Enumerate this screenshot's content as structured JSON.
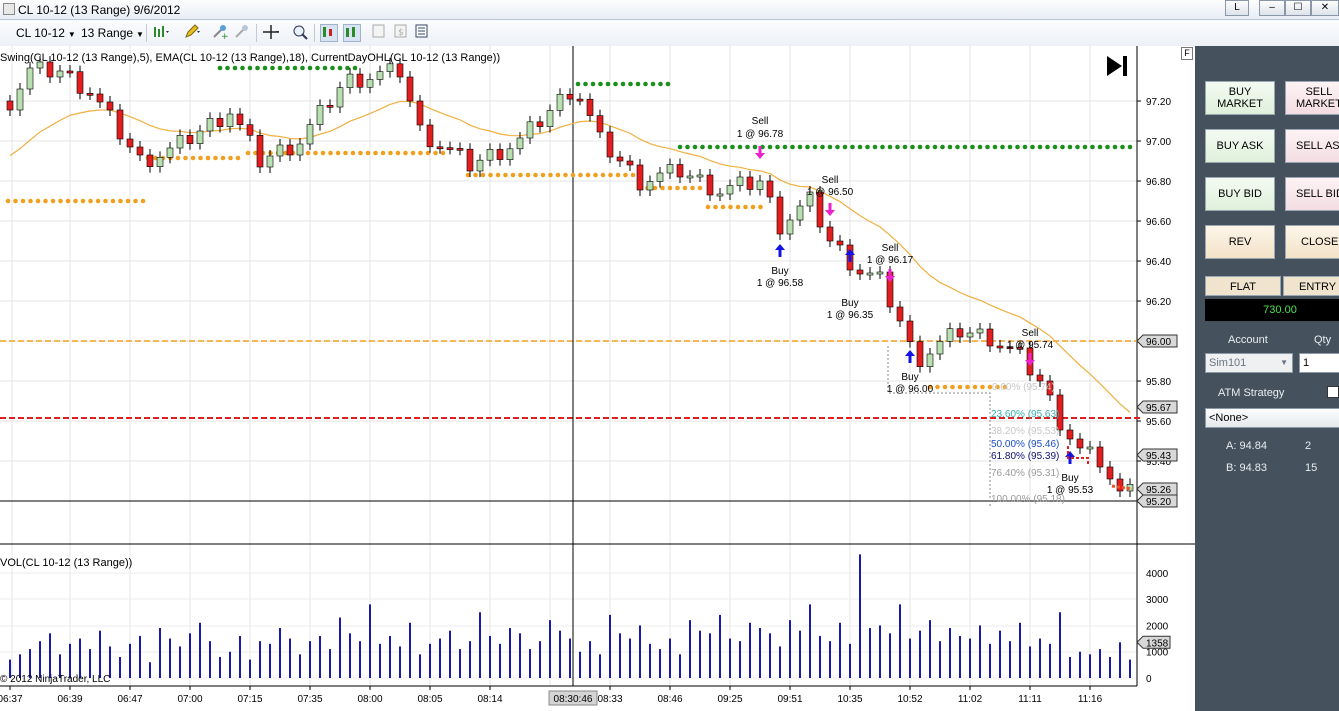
{
  "window": {
    "title": "CL 10-12 (13 Range)  9/6/2012",
    "layout_button": "L",
    "minimize": "–",
    "maximize": "☐",
    "close": "✕"
  },
  "toolbar": {
    "instrument": "CL 10-12",
    "period": "13 Range"
  },
  "colors": {
    "up_candle": "#b8e0b0",
    "down_candle": "#e41e1e",
    "ema": "#f0b040",
    "swing_high": "#1a8f1a",
    "swing_low": "#f0a020",
    "open_line": "#f0a020",
    "prior_line": "#e02020",
    "volume_bar": "#1a1aa8",
    "buy_arrow": "#1414e6",
    "sell_arrow": "#ee22cc",
    "panel_bg": "#45525d"
  },
  "chart": {
    "indicator_label": "Swing(CL 10-12 (13 Range),5), EMA(CL 10-12 (13 Range),18), CurrentDayOHL(CL 10-12 (13 Range))",
    "volume_label": "VOL(CL 10-12 (13 Range))",
    "copyright": "© 2012 NinjaTrader, LLC",
    "crosshair_time": "08:30:46",
    "price_axis": [
      "97.20",
      "97.00",
      "96.80",
      "96.60",
      "96.40",
      "96.20",
      "96.00",
      "95.80",
      "95.60",
      "95.40"
    ],
    "price_tags": [
      "96.00",
      "95.67",
      "95.43",
      "95.26",
      "95.20"
    ],
    "volume_axis": [
      "4000",
      "3000",
      "2000",
      "1000",
      "0"
    ],
    "volume_tag": "1358",
    "time_axis": [
      "06:37",
      "06:39",
      "06:47",
      "07:00",
      "07:15",
      "07:35",
      "08:00",
      "08:05",
      "08:14",
      "08:33",
      "08:46",
      "09:25",
      "09:51",
      "10:35",
      "10:52",
      "11:02",
      "11:11",
      "11:16"
    ],
    "fib_levels": [
      {
        "text": "0.00% (95.74)",
        "color": "#9a9a9a"
      },
      {
        "text": "23.60% (95.63)",
        "color": "#c8c8c8"
      },
      {
        "text": "38.20% (95.53)",
        "color": "#3ab0b0"
      },
      {
        "text": "50.00% (95.46)",
        "color": "#c8c8c8"
      },
      {
        "text": "61.80% (95.39)",
        "color": "#1a4ec8"
      },
      {
        "text": "76.40% (95.31)",
        "color": "#101070"
      },
      {
        "text": "100.00% (95.18)",
        "color": "#9a9a9a"
      }
    ],
    "trades": [
      {
        "side": "Sell",
        "label": "Sell",
        "detail": "1 @ 96.78"
      },
      {
        "side": "Buy",
        "label": "Buy",
        "detail": "1 @ 96.58"
      },
      {
        "side": "Sell",
        "label": "Sell",
        "detail": "1 @ 96.50"
      },
      {
        "side": "Buy",
        "label": "Buy",
        "detail": "1 @ 96.35"
      },
      {
        "side": "Sell",
        "label": "Sell",
        "detail": "1 @ 96.17"
      },
      {
        "side": "Buy",
        "label": "Buy",
        "detail": "1 @ 96.00"
      },
      {
        "side": "Sell",
        "label": "Sell",
        "detail": "1 @ 95.74"
      },
      {
        "side": "Buy",
        "label": "Buy",
        "detail": "1 @ 95.53"
      }
    ]
  },
  "chart_trader": {
    "buy_market": [
      "BUY",
      "MARKET"
    ],
    "sell_market": [
      "SELL",
      "MARKET"
    ],
    "buy_ask": "BUY ASK",
    "sell_ask": "SELL ASK",
    "buy_bid": "BUY BID",
    "sell_bid": "SELL BID",
    "rev": "REV",
    "close": "CLOSE",
    "position": "FLAT",
    "entry": "ENTRY",
    "pnl": "730.00",
    "account_label": "Account",
    "account_value": "Sim101",
    "qty_label": "Qty",
    "qty_value": "1",
    "atm_label": "ATM Strategy",
    "atm_value": "<None>",
    "ask_label": "A: 94.84",
    "ask_size": "2",
    "bid_label": "B: 94.83",
    "bid_size": "15"
  }
}
